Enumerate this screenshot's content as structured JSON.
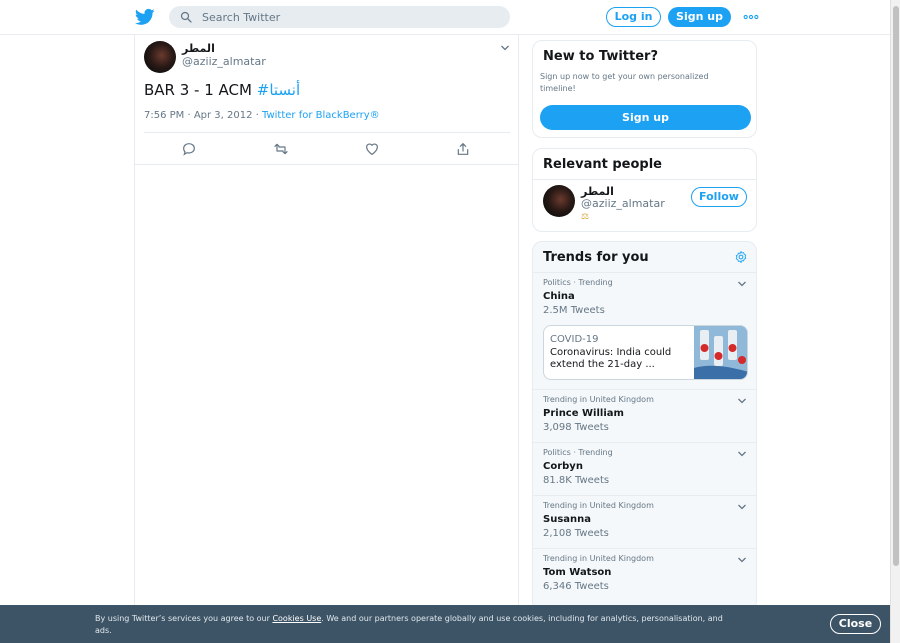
{
  "header": {
    "logo": "twitter-bird-icon",
    "search_placeholder": "Search Twitter",
    "login_label": "Log in",
    "signup_label": "Sign up",
    "more": "more-icon"
  },
  "tweet": {
    "author_name": "المطر",
    "author_handle": "@aziiz_almatar",
    "text_prefix": "BAR 3 - 1 ACM ",
    "hashtag": "#أنستا",
    "time": "7:56 PM · Apr 3, 2012 · ",
    "source": "Twitter for BlackBerry®"
  },
  "sidebar": {
    "new_to_twitter": {
      "title": "New to Twitter?",
      "text": "Sign up now to get your own personalized timeline!",
      "button": "Sign up"
    },
    "relevant_people": {
      "title": "Relevant people",
      "name": "المطر",
      "handle": "@aziiz_almatar",
      "badge": "⚖",
      "follow_label": "Follow"
    },
    "trends": {
      "title": "Trends for you",
      "items": [
        {
          "meta": "Politics · Trending",
          "name": "China",
          "count": "2.5M Tweets"
        },
        {
          "meta": "Trending in United Kingdom",
          "name": "Prince William",
          "count": "3,098 Tweets"
        },
        {
          "meta": "Politics · Trending",
          "name": "Corbyn",
          "count": "81.8K Tweets"
        },
        {
          "meta": "Trending in United Kingdom",
          "name": "Susanna",
          "count": "2,108 Tweets"
        },
        {
          "meta": "Trending in United Kingdom",
          "name": "Tom Watson",
          "count": "6,346 Tweets"
        }
      ],
      "news": {
        "category": "COVID-19",
        "headline": "Coronavirus: India could extend the 21-day ..."
      }
    }
  },
  "cookie": {
    "text_before": "By using Twitter’s services you agree to our ",
    "link": "Cookies Use",
    "text_after": ". We and our partners operate globally and use cookies, including for analytics, personalisation, and ads.",
    "close_label": "Close"
  },
  "colors": {
    "accent": "#1da1f2",
    "banner": "#3d5466",
    "muted": "#657786"
  }
}
